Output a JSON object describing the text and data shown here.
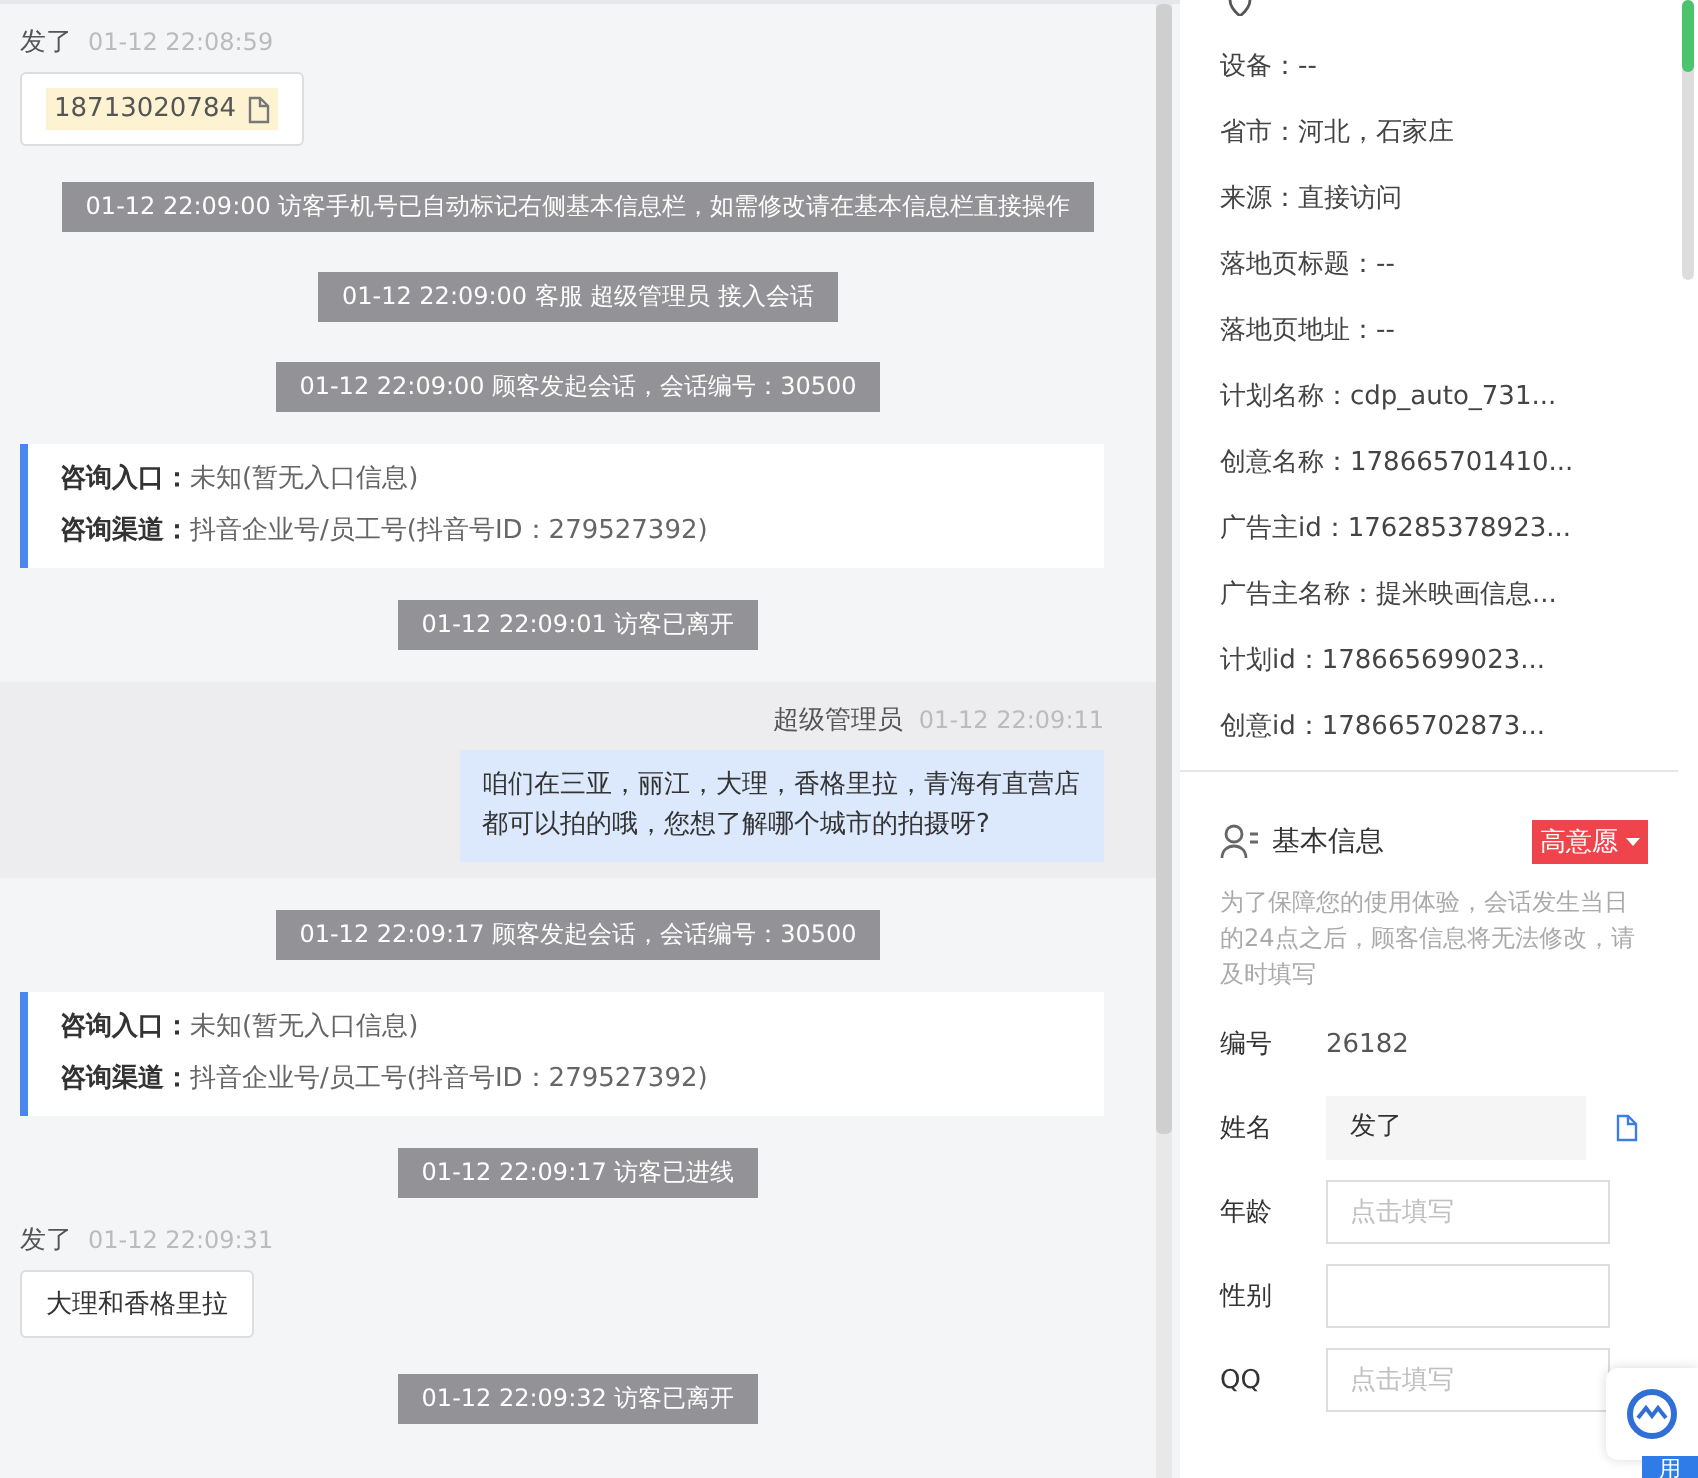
{
  "chat": [
    {
      "kind": "phone",
      "sender": "发了",
      "time": "01-12 22:08:59",
      "text": "18713020784"
    },
    {
      "kind": "system",
      "text": "01-12 22:09:00 访客手机号已自动标记右侧基本信息栏，如需修改请在基本信息栏直接操作"
    },
    {
      "kind": "system",
      "text": "01-12 22:09:00 客服 超级管理员 接入会话"
    },
    {
      "kind": "system",
      "text": "01-12 22:09:00 顾客发起会话，会话编号：30500"
    },
    {
      "kind": "card",
      "rows": [
        {
          "label": "咨询入口：",
          "value": "未知(暂无入口信息)"
        },
        {
          "label": "咨询渠道：",
          "value": "抖音企业号/员工号(抖音号ID：279527392)"
        }
      ]
    },
    {
      "kind": "system",
      "text": "01-12 22:09:01 访客已离开"
    },
    {
      "kind": "agent",
      "sender": "超级管理员",
      "time": "01-12 22:09:11",
      "text": "咱们在三亚，丽江，大理，香格里拉，青海有直营店都可以拍的哦，您想了解哪个城市的拍摄呀?"
    },
    {
      "kind": "system",
      "text": "01-12 22:09:17 顾客发起会话，会话编号：30500"
    },
    {
      "kind": "card",
      "rows": [
        {
          "label": "咨询入口：",
          "value": "未知(暂无入口信息)"
        },
        {
          "label": "咨询渠道：",
          "value": "抖音企业号/员工号(抖音号ID：279527392)"
        }
      ]
    },
    {
      "kind": "system",
      "text": "01-12 22:09:17 访客已进线"
    },
    {
      "kind": "text",
      "sender": "发了",
      "time": "01-12 22:09:31",
      "text": "大理和香格里拉"
    },
    {
      "kind": "system",
      "text": "01-12 22:09:32 访客已离开"
    }
  ],
  "source_info": [
    "设备：--",
    "省市：河北，石家庄",
    "来源：直接访问",
    "落地页标题：--",
    "落地页地址：--",
    "计划名称：cdp_auto_731...",
    "创意名称：178665701410...",
    "广告主id：176285378923...",
    "广告主名称：提米映画信息...",
    "计划id：178665699023...",
    "创意id：178665702873..."
  ],
  "basic_info": {
    "title": "基本信息",
    "intent_tag": "高意愿",
    "notice": "为了保障您的使用体验，会话发生当日的24点之后，顾客信息将无法修改，请及时填写",
    "fields": [
      {
        "kind": "static",
        "label": "编号",
        "value": "26182"
      },
      {
        "kind": "readonly",
        "label": "姓名",
        "value": "发了"
      },
      {
        "kind": "input",
        "label": "年龄",
        "placeholder": "点击填写"
      },
      {
        "kind": "input",
        "label": "性别"
      },
      {
        "kind": "input",
        "label": "QQ",
        "placeholder": "点击填写"
      }
    ]
  },
  "corner_button": "用"
}
